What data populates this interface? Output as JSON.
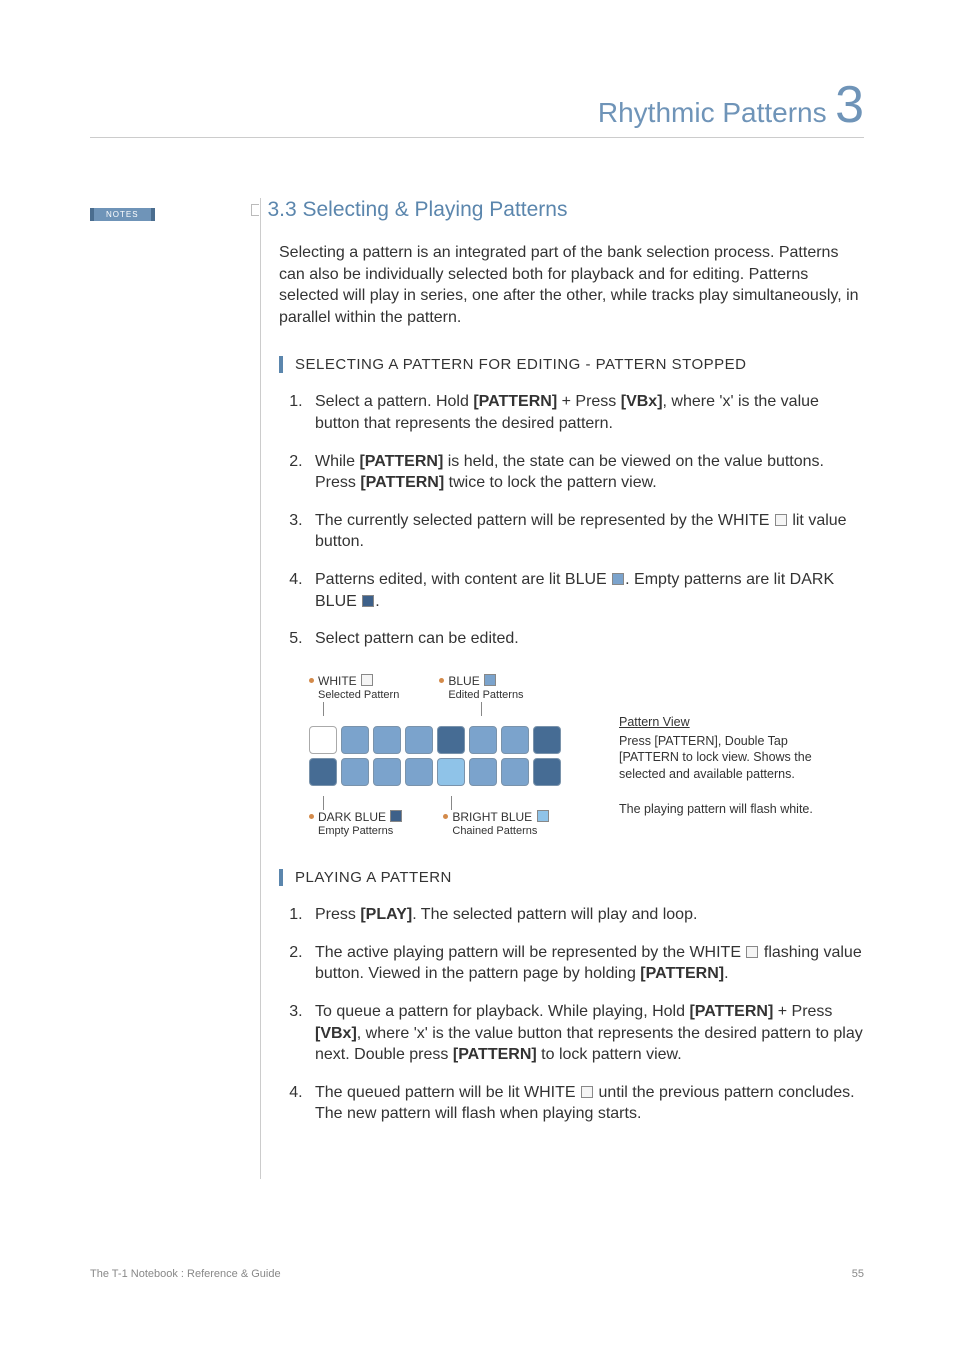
{
  "chapter": {
    "title": "Rhythmic Patterns",
    "number": "3"
  },
  "notes_label": "NOTES",
  "section": {
    "heading": "3.3 Selecting & Playing Patterns",
    "intro": "Selecting a pattern is an integrated part of the bank selection process. Patterns can also be individually selected both for playback and for editing. Patterns selected will play in series, one after the other, while tracks play simultaneously, in parallel within the pattern."
  },
  "sub1": {
    "title": "SELECTING A PATTERN FOR EDITING - PATTERN STOPPED",
    "s1a": "Select a pattern. Hold ",
    "s1b": "[PATTERN]",
    "s1c": " + Press ",
    "s1d": "[VBx]",
    "s1e": ", where 'x' is the value button that represents the desired pattern.",
    "s2a": "While ",
    "s2b": "[PATTERN]",
    "s2c": " is held, the state can be viewed on the value buttons. Press ",
    "s2d": "[PATTERN]",
    "s2e": " twice to lock the pattern view.",
    "s3a": "The currently selected pattern will be represented by the WHITE ",
    "s3b": " lit value button.",
    "s4a": "Patterns edited, with content are lit BLUE ",
    "s4b": ".  Empty patterns are lit DARK BLUE ",
    "s4c": ".",
    "s5": "Select pattern can be edited."
  },
  "diagram": {
    "legend": {
      "white_t": "WHITE",
      "white_s": "Selected Pattern",
      "blue_t": "BLUE",
      "blue_s": "Edited Patterns",
      "dblue_t": "DARK BLUE",
      "dblue_s": "Empty Patterns",
      "bblue_t": "BRIGHT BLUE",
      "bblue_s": "Chained Patterns"
    },
    "side": {
      "pv_title": "Pattern View",
      "pv_body": "Press [PATTERN], Double Tap [PATTERN to lock view. Shows the selected and available patterns.",
      "note": "The playing pattern will flash white."
    }
  },
  "sub2": {
    "title": "PLAYING A PATTERN",
    "s1a": "Press ",
    "s1b": "[PLAY]",
    "s1c": ". The selected pattern will play and loop.",
    "s2a": "The active playing pattern will be represented by the WHITE ",
    "s2b": " flashing value button. Viewed in the pattern page by holding ",
    "s2c": "[PATTERN]",
    "s2d": ".",
    "s3a": "To queue a pattern for playback. While playing, Hold ",
    "s3b": "[PATTERN]",
    "s3c": " + Press ",
    "s3d": "[VBx]",
    "s3e": ", where 'x' is the value button that represents the desired pattern to play next. Double press ",
    "s3f": "[PATTERN]",
    "s3g": " to lock pattern view.",
    "s4a": "The queued pattern will be lit WHITE ",
    "s4b": " until the previous pattern concludes. The new pattern will flash when playing starts."
  },
  "footer": {
    "left": "The T-1 Notebook : Reference & Guide",
    "page": "55"
  },
  "chart_data": {
    "type": "heatmap",
    "title": "Pattern View pad grid",
    "rows": 2,
    "cols": 8,
    "legend": {
      "white": "Selected Pattern",
      "blue": "Edited Patterns",
      "dark_blue": "Empty Patterns",
      "bright_blue": "Chained Patterns"
    },
    "grid": [
      [
        "white",
        "blue",
        "blue",
        "blue",
        "dark_blue",
        "blue",
        "blue",
        "dark_blue"
      ],
      [
        "dark_blue",
        "blue",
        "blue",
        "blue",
        "bright_blue",
        "blue",
        "blue",
        "dark_blue"
      ]
    ]
  }
}
